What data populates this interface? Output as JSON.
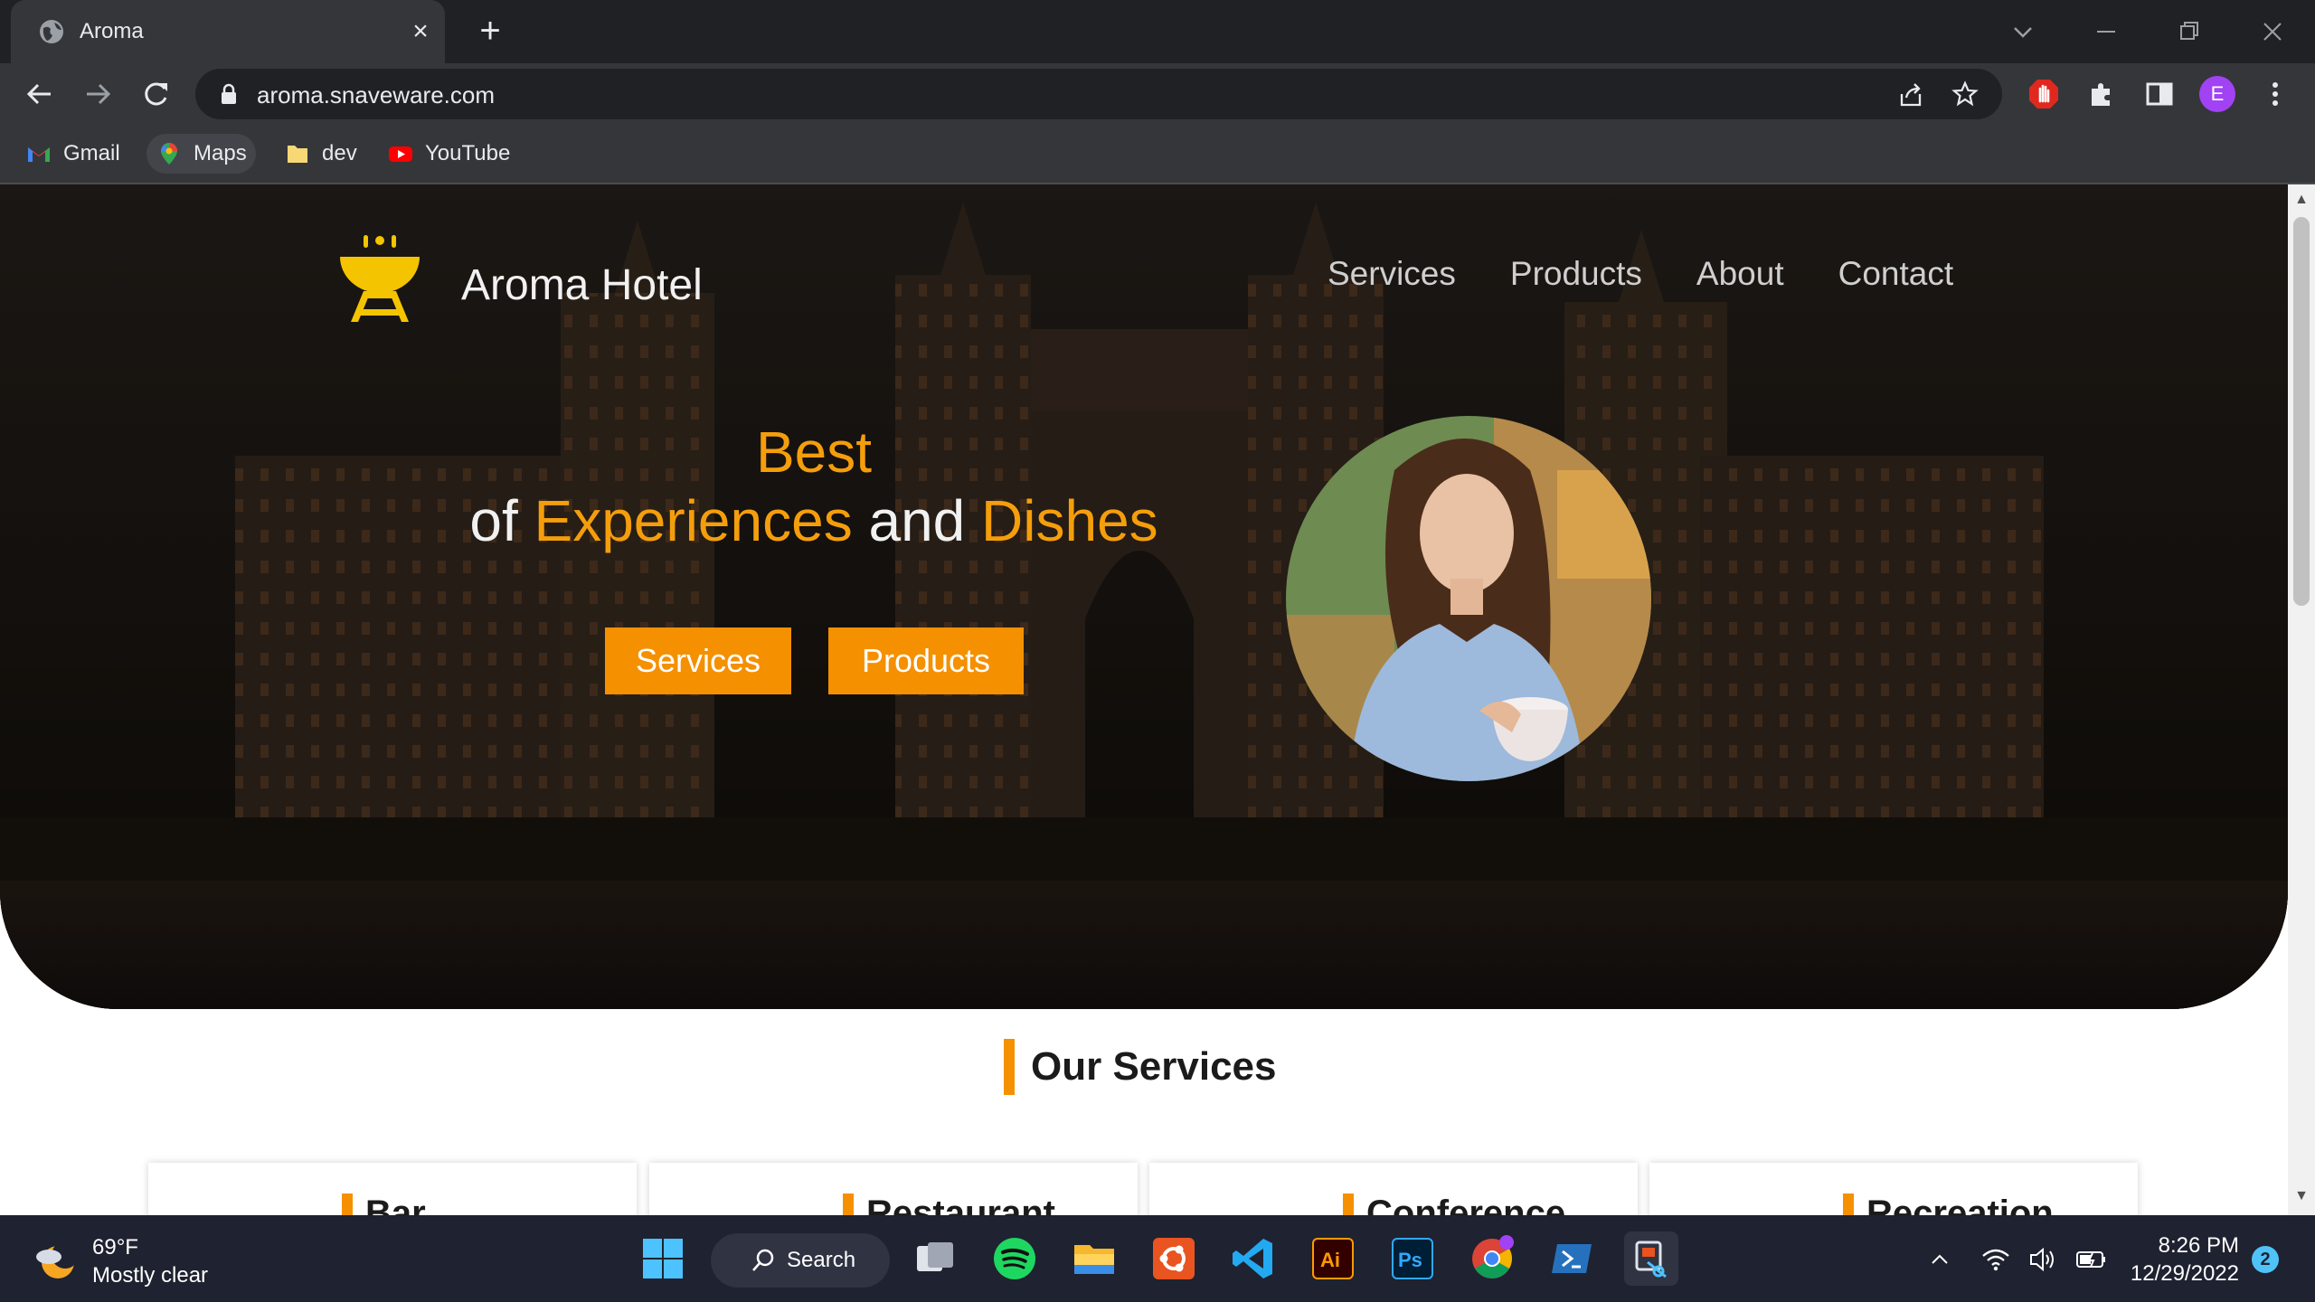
{
  "browser": {
    "tab_title": "Aroma",
    "url": "aroma.snaveware.com",
    "profile_initial": "E",
    "bookmarks": [
      {
        "label": "Gmail",
        "icon": "gmail-icon"
      },
      {
        "label": "Maps",
        "icon": "maps-icon"
      },
      {
        "label": "dev",
        "icon": "folder-icon"
      },
      {
        "label": "YouTube",
        "icon": "youtube-icon"
      }
    ]
  },
  "site": {
    "brand": "Aroma Hotel",
    "nav": [
      "Services",
      "Products",
      "About",
      "Contact"
    ],
    "headline": {
      "line1": "Best",
      "of": "of ",
      "experiences": "Experiences",
      "and": " and ",
      "dishes": "Dishes"
    },
    "buttons": {
      "services": "Services",
      "products": "Products"
    },
    "accent_color": "#f59000",
    "section_title": "Our Services",
    "cards": [
      "Bar",
      "Restaurant",
      "Conference",
      "Recreation"
    ]
  },
  "taskbar": {
    "weather_temp": "69°F",
    "weather_desc": "Mostly clear",
    "search_label": "Search",
    "time": "8:26 PM",
    "date": "12/29/2022",
    "notification_count": "2"
  }
}
